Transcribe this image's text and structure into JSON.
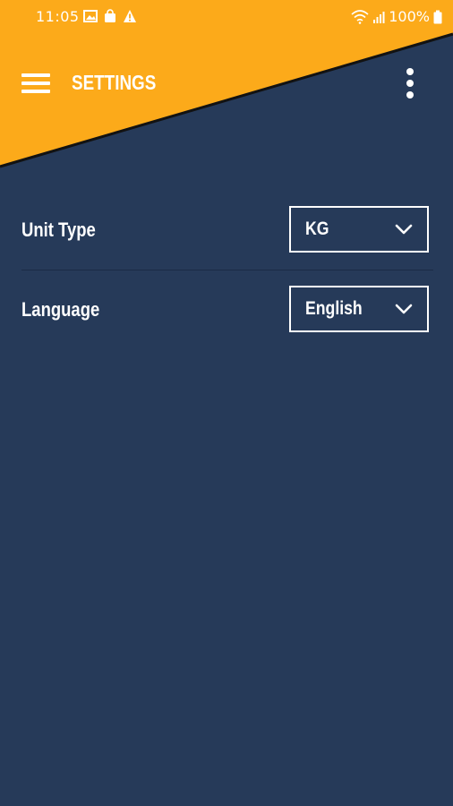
{
  "status_bar": {
    "time": "11:05",
    "battery": "100%",
    "left_icons": [
      "image-icon",
      "bag-icon",
      "warning-icon"
    ],
    "right_icons": [
      "wifi-icon",
      "signal-icon",
      "battery-icon"
    ]
  },
  "toolbar": {
    "title": "SETTINGS",
    "menu_icon": "hamburger-menu-icon",
    "more_icon": "more-vertical-icon"
  },
  "settings": {
    "unit_type": {
      "label": "Unit Type",
      "value": "KG"
    },
    "language": {
      "label": "Language",
      "value": "English"
    }
  },
  "colors": {
    "background": "#263a59",
    "header_accent": "#fcaa1a",
    "header_edge": "#121212",
    "text": "#ffffff"
  }
}
